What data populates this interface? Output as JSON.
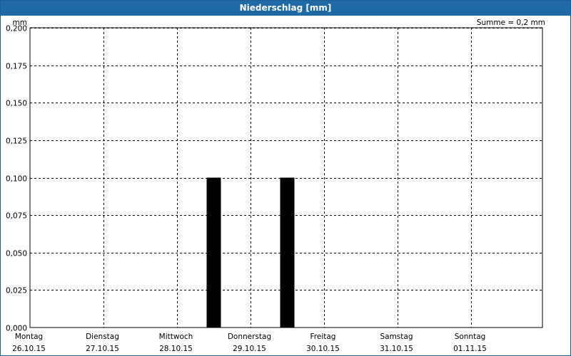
{
  "window": {
    "title": "Niederschlag [mm]"
  },
  "summary": {
    "total_label": "Summe = 0,2 mm"
  },
  "chart_data": {
    "type": "bar",
    "title": "Niederschlag [mm]",
    "ylabel": "mm",
    "xlabel": "",
    "ylim": [
      0,
      0.2
    ],
    "yticks": [
      0,
      0.025,
      0.05,
      0.075,
      0.1,
      0.125,
      0.15,
      0.175,
      0.2
    ],
    "ytick_labels": [
      "0,000",
      "0,025",
      "0,050",
      "0,075",
      "0,100",
      "0,125",
      "0,150",
      "0,175",
      "0,200"
    ],
    "x_axis": {
      "days": [
        {
          "weekday": "Montag",
          "date": "26.10.15"
        },
        {
          "weekday": "Dienstag",
          "date": "27.10.15"
        },
        {
          "weekday": "Mittwoch",
          "date": "28.10.15"
        },
        {
          "weekday": "Donnerstag",
          "date": "29.10.15"
        },
        {
          "weekday": "Freitag",
          "date": "30.10.15"
        },
        {
          "weekday": "Samstag",
          "date": "31.10.15"
        },
        {
          "weekday": "Sonntag",
          "date": "01.11.15"
        }
      ],
      "range": [
        "2015-10-26 00:00",
        "2015-11-02 00:00"
      ]
    },
    "series": [
      {
        "color": "#000000",
        "points": [
          {
            "x": "2015-10-28 12:00",
            "y": 0.1
          },
          {
            "x": "2015-10-29 12:00",
            "y": 0.1
          }
        ]
      }
    ],
    "grid": true,
    "legend": "none"
  }
}
